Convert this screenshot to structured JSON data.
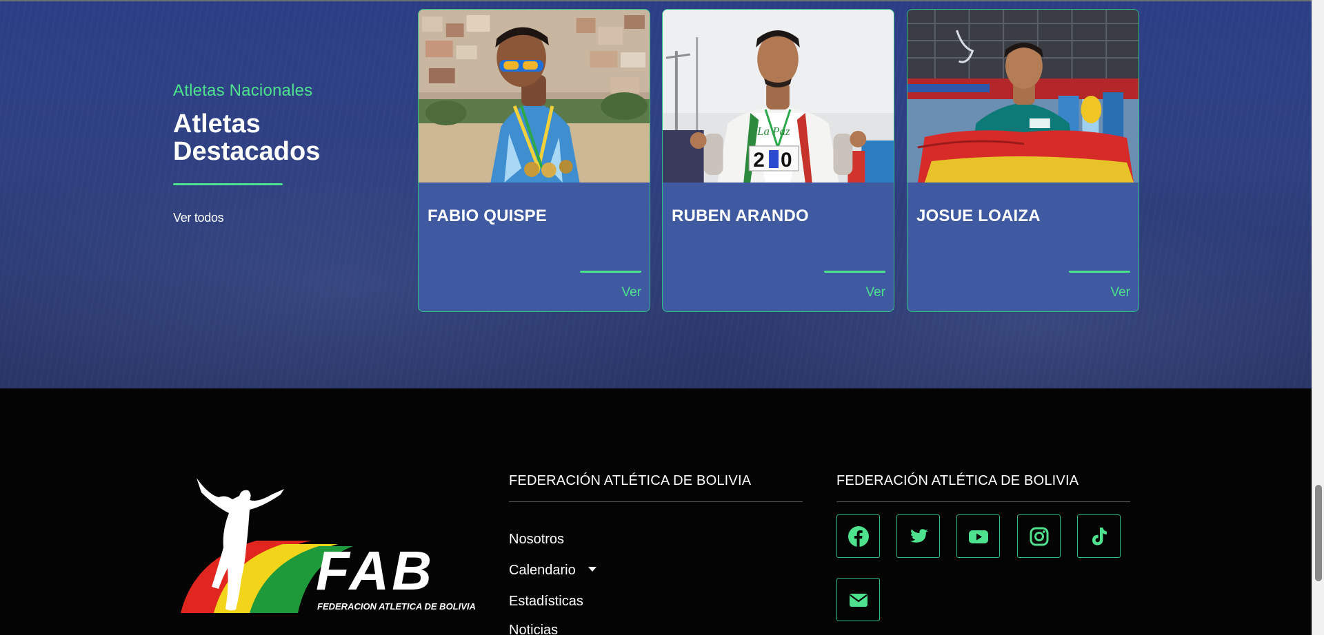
{
  "featured": {
    "eyebrow": "Atletas Nacionales",
    "title": "Atletas Destacados",
    "view_all": "Ver todos",
    "athletes": [
      {
        "name": "FABIO QUISPE",
        "action": "Ver"
      },
      {
        "name": "RUBEN ARANDO",
        "action": "Ver"
      },
      {
        "name": "JOSUE LOAIZA",
        "action": "Ver"
      }
    ]
  },
  "footer": {
    "logo_text": "FAB",
    "logo_subtitle": "FEDERACION ATLETICA DE BOLIVIA",
    "nav_title": "FEDERACIÓN ATLÉTICA DE BOLIVIA",
    "nav_links": [
      "Nosotros",
      "Calendario",
      "Estadísticas",
      "Noticias"
    ],
    "social_title": "FEDERACIÓN ATLÉTICA DE BOLIVIA",
    "social_icons": [
      "facebook-icon",
      "twitter-icon",
      "youtube-icon",
      "instagram-icon",
      "tiktok-icon",
      "email-icon"
    ]
  },
  "colors": {
    "accent": "#4ee28f",
    "card_bg": "#3f5aa1",
    "hero_bg": "#2f4182",
    "footer_bg": "#040404"
  }
}
